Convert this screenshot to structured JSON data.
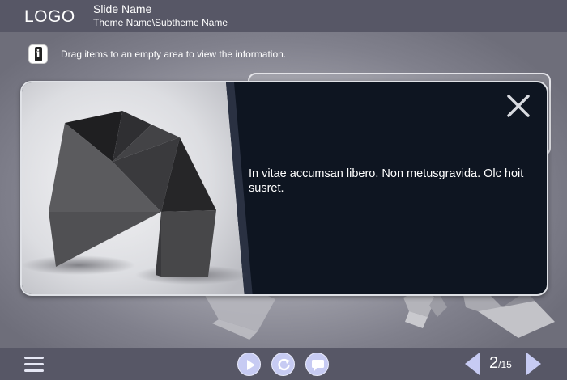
{
  "header": {
    "logo": "LOGO",
    "slide_name": "Slide Name",
    "theme_name": "Theme Name\\Subtheme Name"
  },
  "instruction": {
    "icon": "info-icon",
    "text": "Drag items to an empty area to view the information."
  },
  "popup": {
    "text": "In vitae accumsan libero. Non metusgravida. Olc hoit susret.",
    "close_icon": "close-icon"
  },
  "footer": {
    "menu_icon": "hamburger-icon",
    "controls": [
      "play-icon",
      "replay-icon",
      "comment-icon"
    ],
    "page_current": "2",
    "page_total": "/15"
  },
  "colors": {
    "bar": "#575766",
    "popup_bg": "#0e1521",
    "button": "#c7cbf3"
  }
}
